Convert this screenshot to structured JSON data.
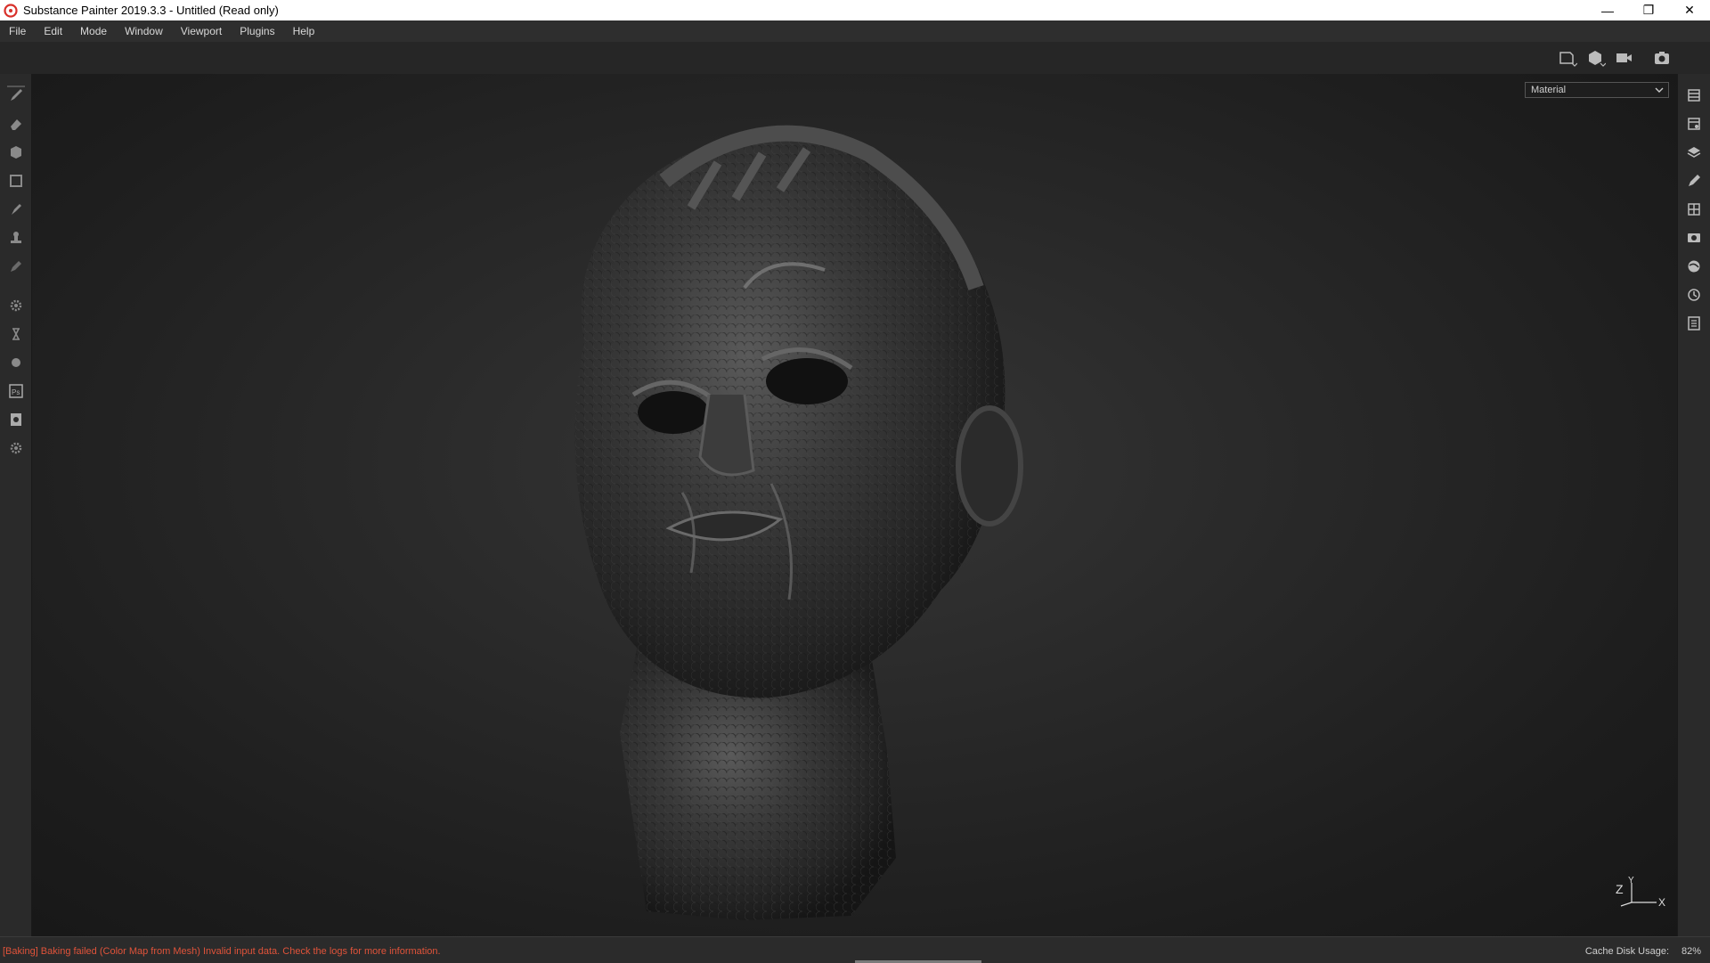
{
  "window": {
    "title": "Substance Painter 2019.3.3 - Untitled (Read only)",
    "controls": [
      "minimize-icon",
      "restore-icon",
      "close-icon"
    ]
  },
  "menu": {
    "items": [
      "File",
      "Edit",
      "Mode",
      "Window",
      "Viewport",
      "Plugins",
      "Help"
    ]
  },
  "toptoolbar": {
    "icons": [
      "view-2d-3d-icon",
      "display-mode-icon",
      "camera-icon",
      "screenshot-icon"
    ]
  },
  "lefttools": {
    "icons": [
      "paint-brush-icon",
      "eraser-icon",
      "projection-icon",
      "polygon-fill-icon",
      "smudge-icon",
      "clone-stamp-icon",
      "color-picker-icon",
      "settings-gear-icon",
      "bake-icon",
      "sphere-icon",
      "photoshop-export-icon",
      "render-icon",
      "plugin-gear-icon"
    ]
  },
  "righttools": {
    "icons": [
      "texture-set-list-icon",
      "texture-set-settings-icon",
      "layers-icon",
      "properties-icon",
      "shelf-icon",
      "display-settings-icon",
      "shader-settings-icon",
      "history-icon",
      "log-icon"
    ]
  },
  "viewport": {
    "channel_value": "Material",
    "axis_labels": {
      "z": "Z",
      "y": "Y",
      "x": "X"
    }
  },
  "status": {
    "message": "[Baking] Baking failed (Color Map from Mesh) Invalid input data. Check the logs for more information.",
    "cache_label": "Cache Disk Usage:",
    "cache_value": "82%"
  },
  "colors": {
    "error_text": "#e0533a",
    "panel_bg": "#2a2a2a",
    "viewport_bg": "#1d1d1d"
  }
}
